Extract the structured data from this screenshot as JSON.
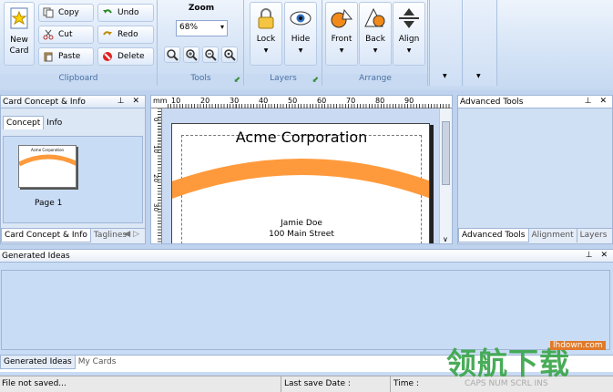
{
  "ribbon": {
    "new_card": "New\nCard",
    "copy": "Copy",
    "cut": "Cut",
    "paste": "Paste",
    "undo": "Undo",
    "redo": "Redo",
    "delete": "Delete",
    "clipboard": "Clipboard",
    "zoom_title": "Zoom",
    "zoom_value": "68%",
    "tools": "Tools",
    "lock": "Lock",
    "hide": "Hide",
    "layers": "Layers",
    "front": "Front",
    "back": "Back",
    "align": "Align",
    "arrange": "Arrange"
  },
  "left_panel": {
    "title": "Card Concept & Info",
    "tab_concept": "Concept",
    "tab_info": "Info",
    "page_label": "Page 1",
    "thumb_title": "Acme Corporation",
    "bottom_tab1": "Card Concept & Info",
    "bottom_tab2": "Taglines"
  },
  "canvas": {
    "unit": "mm",
    "ticks": [
      "10",
      "20",
      "30",
      "40",
      "50",
      "60",
      "70",
      "80",
      "90"
    ],
    "vticks": [
      "0",
      "10",
      "20",
      "30"
    ],
    "company": "Acme Corporation",
    "name": "Jamie Doe",
    "street": "100 Main Street"
  },
  "right_panel": {
    "title": "Advanced Tools",
    "tab1": "Advanced Tools",
    "tab2": "Alignment",
    "tab3": "Layers"
  },
  "ideas": {
    "title": "Generated Ideas",
    "tab1": "Generated Ideas",
    "tab2": "My Cards"
  },
  "status": {
    "file": "File not saved...",
    "last_save": "Last save Date :",
    "time": "Time :",
    "caps": "CAPS NUM SCRL INS"
  },
  "watermark": {
    "chars": "领航下载",
    "site": "lhdown.com"
  },
  "colors": {
    "accent": "#ff9a3c",
    "panel": "#c9dcf5"
  }
}
